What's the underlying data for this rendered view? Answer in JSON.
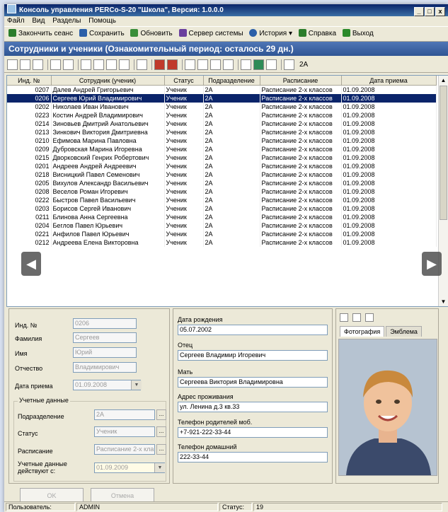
{
  "window": {
    "title": "Консоль управления PERCo-S-20 \"Школа\", Версия: 1.0.0.0",
    "btn_min": "_",
    "btn_max": "□",
    "btn_close": "x"
  },
  "menu": [
    "Файл",
    "Вид",
    "Разделы",
    "Помощь"
  ],
  "toolbar": [
    {
      "label": "Закончить сеанс",
      "color": "#2b7d2b"
    },
    {
      "label": "Сохранить",
      "color": "#2b5fa8"
    },
    {
      "label": "Обновить",
      "color": "#3a8f3a"
    },
    {
      "label": "Сервер системы",
      "color": "#6a3f9e"
    },
    {
      "label": "История",
      "color": "#2b5fa8"
    },
    {
      "label": "Справка",
      "color": "#2b7d2b"
    },
    {
      "label": "Выход",
      "color": "#2b8a2b"
    }
  ],
  "banner": "Сотрудники и ученики (Ознакомительный период: осталось 29 дн.)",
  "toolbar2_text": "2А",
  "table": {
    "columns": [
      "Инд. №",
      "Сотрудник (ученик)",
      "Статус",
      "Подразделение",
      "Расписание",
      "Дата приема"
    ],
    "rows": [
      [
        "0207",
        "Далев Андрей Григорьевич",
        "Ученик",
        "2А",
        "Расписание 2-х классов",
        "01.09.2008"
      ],
      [
        "0206",
        "Сергеев Юрий Владимирович",
        "Ученик",
        "2А",
        "Расписание 2-х классов",
        "01.09.2008"
      ],
      [
        "0202",
        "Николаев Иван Иванович",
        "Ученик",
        "2А",
        "Расписание 2-х классов",
        "01.09.2008"
      ],
      [
        "0223",
        "Костин Андрей Владимирович",
        "Ученик",
        "2А",
        "Расписание 2-х классов",
        "01.09.2008"
      ],
      [
        "0214",
        "Зиновьев Дмитрий Анатольевич",
        "Ученик",
        "2А",
        "Расписание 2-х классов",
        "01.09.2008"
      ],
      [
        "0213",
        "Зинкович Виктория Дмитриевна",
        "Ученик",
        "2А",
        "Расписание 2-х классов",
        "01.09.2008"
      ],
      [
        "0210",
        "Ефимова Марина Павловна",
        "Ученик",
        "2А",
        "Расписание 2-х классов",
        "01.09.2008"
      ],
      [
        "0209",
        "Дубровская Марина Игоревна",
        "Ученик",
        "2А",
        "Расписание 2-х классов",
        "01.09.2008"
      ],
      [
        "0215",
        "Дворковский Генрих Робертович",
        "Ученик",
        "2А",
        "Расписание 2-х классов",
        "01.09.2008"
      ],
      [
        "0201",
        "Андреев Андрей Андреевич",
        "Ученик",
        "2А",
        "Расписание 2-х классов",
        "01.09.2008"
      ],
      [
        "0218",
        "Висницкий Павел Семенович",
        "Ученик",
        "2А",
        "Расписание 2-х классов",
        "01.09.2008"
      ],
      [
        "0205",
        "Вихулов Александр Васильевич",
        "Ученик",
        "2А",
        "Расписание 2-х классов",
        "01.09.2008"
      ],
      [
        "0208",
        "Веселов Роман Игоревич",
        "Ученик",
        "2А",
        "Расписание 2-х классов",
        "01.09.2008"
      ],
      [
        "0222",
        "Быстров Павел Васильевич",
        "Ученик",
        "2А",
        "Расписание 2-х классов",
        "01.09.2008"
      ],
      [
        "0203",
        "Борисов Сергей Иванович",
        "Ученик",
        "2А",
        "Расписание 2-х классов",
        "01.09.2008"
      ],
      [
        "0211",
        "Блинова Анна Сергеевна",
        "Ученик",
        "2А",
        "Расписание 2-х классов",
        "01.09.2008"
      ],
      [
        "0204",
        "Беглов Павел Юрьевич",
        "Ученик",
        "2А",
        "Расписание 2-х классов",
        "01.09.2008"
      ],
      [
        "0221",
        "Анфилов Павел Юрьевич",
        "Ученик",
        "2А",
        "Расписание 2-х классов",
        "01.09.2008"
      ],
      [
        "0212",
        "Андреева Елена Викторовна",
        "Ученик",
        "2А",
        "Расписание 2-х классов",
        "01.09.2008"
      ]
    ],
    "selected_index": 1
  },
  "form": {
    "ind_label": "Инд. №",
    "ind_value": "0206",
    "lastname_label": "Фамилия",
    "lastname_value": "Сергеев",
    "firstname_label": "Имя",
    "firstname_value": "Юрий",
    "patronymic_label": "Отчество",
    "patronymic_value": "Владимирович",
    "hire_label": "Дата приема",
    "hire_value": "01.09.2008",
    "group_title": "Учетные данные",
    "dept_label": "Подразделение",
    "dept_value": "2А",
    "status_label": "Статус",
    "status_value": "Ученик",
    "schedule_label": "Расписание",
    "schedule_value": "Расписание 2-х кла",
    "valid_label": "Учетные данные действуют с:",
    "valid_value": "01.09.2009",
    "ellipsis": "..."
  },
  "details": {
    "birth_label": "Дата рождения",
    "birth_value": "05.07.2002",
    "father_label": "Отец",
    "father_value": "Сергеев Владимир Игоревич",
    "mother_label": "Мать",
    "mother_value": "Сергеева Виктория Владимировна",
    "address_label": "Адрес проживания",
    "address_value": "ул. Ленина д.3 кв.33",
    "parents_phone_label": "Телефон родителей моб.",
    "parents_phone_value": "+7-921-222-33-44",
    "home_phone_label": "Телефон домашний",
    "home_phone_value": "222-33-44"
  },
  "photo_tabs": [
    "Фотография",
    "Эмблема"
  ],
  "buttons": {
    "ok": "OK",
    "cancel": "Отмена"
  },
  "status": {
    "user_label": "Пользователь:",
    "user_value": "ADMIN",
    "status_label": "Статус:",
    "status_value": "19"
  }
}
